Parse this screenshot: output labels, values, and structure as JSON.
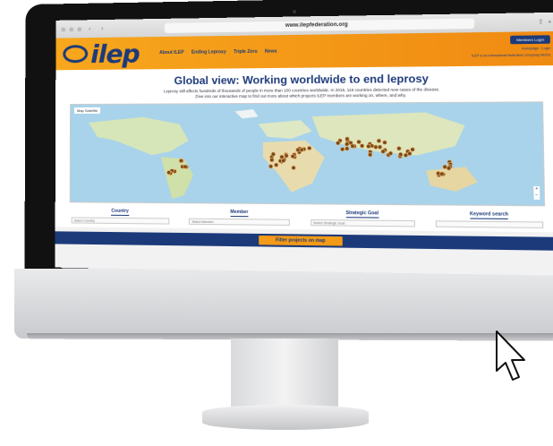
{
  "browser": {
    "url": "www.ilepfederation.org",
    "back_icon": "back-icon",
    "forward_icon": "forward-icon"
  },
  "header": {
    "logo_text": "ilep",
    "nav": [
      "About ILEP",
      "Ending Leprosy",
      "Triple Zero",
      "News"
    ],
    "member_login": "Members Login",
    "right_note": "Homepage · Login",
    "tagline": "ILEP is an international federation of leprosy NGOs"
  },
  "main": {
    "title": "Global view: Working worldwide to end leprosy",
    "intro": "Leprosy still affects hundreds of thousands of people in more than 100 countries worldwide. In 2016, 116 countries detected new cases of the disease.",
    "intro2": "Dive into our interactive map to find out more about which projects ILEP members are working on, where, and why."
  },
  "map": {
    "toggle_label": "Map  Satellite",
    "zoom_plus": "+",
    "zoom_minus": "−"
  },
  "filters": [
    {
      "label": "Country",
      "placeholder": "Select Country"
    },
    {
      "label": "Member",
      "placeholder": "Select Member"
    },
    {
      "label": "Strategic Goal",
      "placeholder": "Select Strategic Goal"
    },
    {
      "label": "Keyword search",
      "placeholder": ""
    }
  ],
  "actions": {
    "filter_button": "Filter projects on map"
  },
  "colors": {
    "brand_orange": "#f39a16",
    "brand_navy": "#1c3a7a"
  }
}
